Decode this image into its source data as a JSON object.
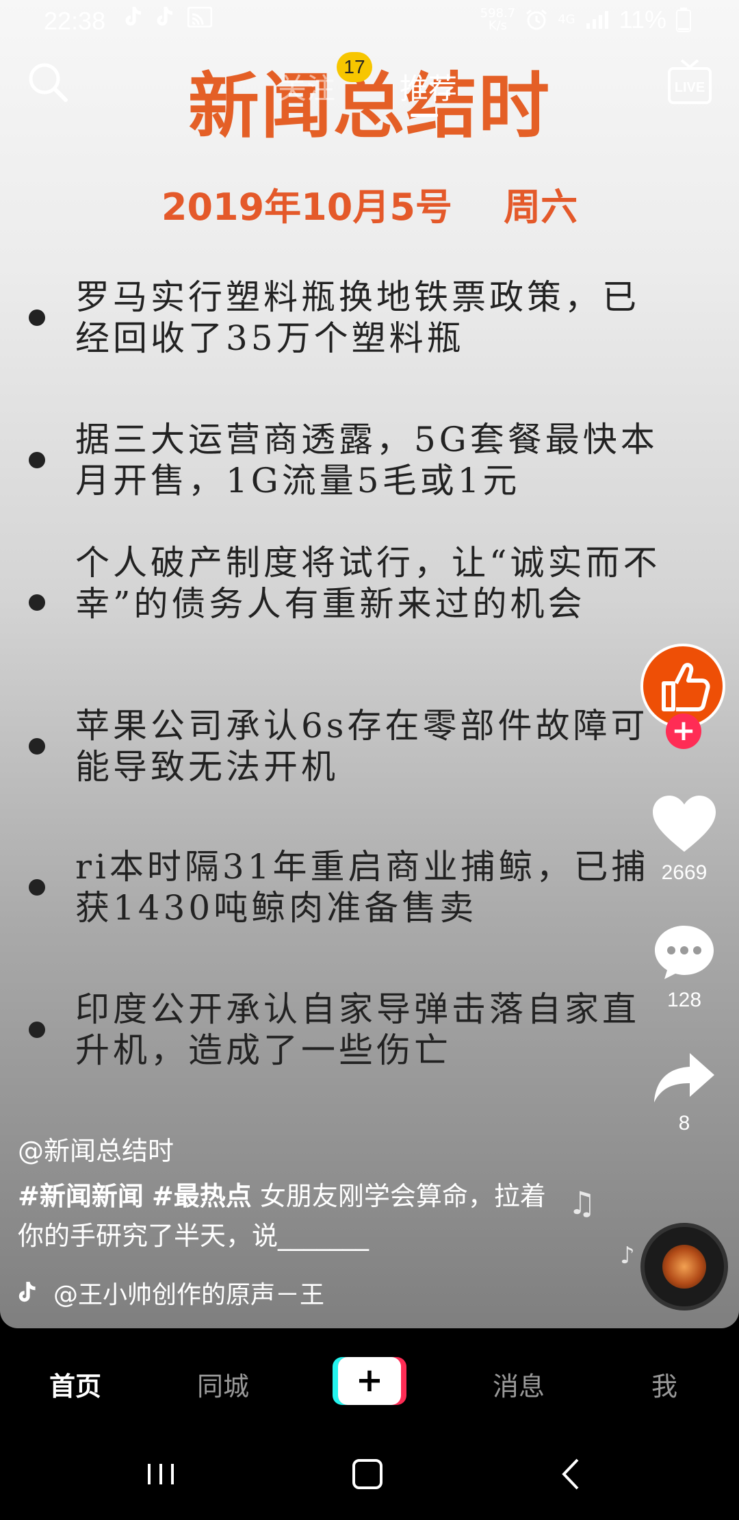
{
  "status_bar": {
    "time": "22:38",
    "net_speed_value": "598.7",
    "net_speed_unit": "K/s",
    "network": "4G",
    "battery": "11%",
    "icons": [
      "tiktok-icon",
      "tiktok-icon",
      "cast-icon",
      "alarm-icon",
      "signal-icon",
      "battery-icon"
    ]
  },
  "top_nav": {
    "tabs": [
      {
        "label": "关注",
        "badge": "17"
      },
      {
        "label": "推荐"
      }
    ],
    "active_tab": "推荐",
    "search_icon": "search-icon",
    "live_label": "LIVE"
  },
  "video": {
    "title": "新闻总结时",
    "date": "2019年10月5号    周六",
    "items": [
      {
        "text": "罗马实行塑料瓶换地铁票政策，已经回收了35万个塑料瓶"
      },
      {
        "text": "据三大运营商透露，5G套餐最快本月开售，1G流量5毛或1元"
      },
      {
        "text": "个人破产制度将试行，让“诚实而不幸”的债务人有重新来过的机会"
      },
      {
        "text": "苹果公司承认6s存在零部件故障可能导致无法开机"
      },
      {
        "text": "ri本时隔31年重启商业捕鲸，已捕获1430吨鲸肉准备售卖"
      },
      {
        "text": "印度公开承认自家导弹击落自家直升机，造成了一些伤亡"
      }
    ],
    "colors": {
      "title": "#e45f26",
      "text": "#222222"
    }
  },
  "actions": {
    "avatar_icon": "thumbs-up-icon",
    "likes": "2669",
    "comments": "128",
    "shares": "8"
  },
  "caption": {
    "author": "@新闻总结时",
    "tag1": "#新闻新闻",
    "tag2": "#最热点",
    "text": " 女朋友刚学会算命，拉着你的手研究了半天，说_______",
    "music": "@王小帅创作的原声－王"
  },
  "bottom_tabs": {
    "home": "首页",
    "nearby": "同城",
    "create": "+",
    "messages": "消息",
    "me": "我"
  },
  "brand_colors": {
    "accent_red": "#fe2c55",
    "accent_cyan": "#25f4ee",
    "badge_yellow": "#f7c600"
  }
}
